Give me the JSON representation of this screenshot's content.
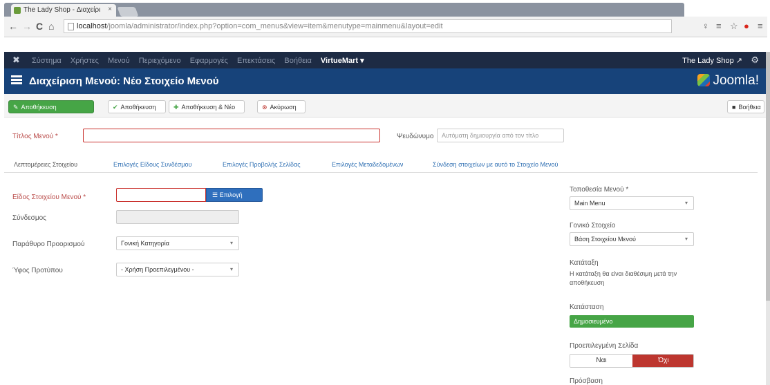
{
  "browser": {
    "tab_title": "The Lady Shop - Διαχείρι",
    "tab_close": "×",
    "url_host": "localhost",
    "url_rest": "/joomla/administrator/index.php?option=com_menus&view=item&menutype=mainmenu&layout=edit",
    "back": "←",
    "forward": "→",
    "reload": "C",
    "home": "⌂",
    "ext_icons": [
      "♀",
      "≡",
      "☆",
      "●",
      "≡"
    ]
  },
  "adminbar": {
    "logo": "✖",
    "menu": [
      "Σύστημα",
      "Χρήστες",
      "Μενού",
      "Περιεχόμενο",
      "Εφαρμογές",
      "Επεκτάσεις",
      "Βοήθεια"
    ],
    "virtuemart": "VirtueMart ▾",
    "site": "The Lady Shop ↗",
    "gear": "⚙"
  },
  "titlebar": {
    "title": "Διαχείριση Μενού: Νέο Στοιχείο Μενού",
    "brand": "Joomla!"
  },
  "toolbar": {
    "save": "Αποθήκευση",
    "save_close": "Αποθήκευση",
    "save_new": "Αποθήκευση & Νέο",
    "cancel": "Ακύρωση",
    "help": "Βοήθεια"
  },
  "form": {
    "title_label": "Τίτλος Μενού *",
    "alias_label": "Ψευδώνυμο",
    "alias_placeholder": "Αυτόματη δημιουργία από τον τίτλο",
    "tabs": [
      "Λεπτομέρειες Στοιχείου",
      "Επιλογές Είδους Συνδέσμου",
      "Επιλογές Προβολής Σελίδας",
      "Επιλογές Μεταδεδομένων",
      "Σύνδεση στοιχείων με αυτό το Στοιχείο Μενού"
    ],
    "type_label": "Είδος Στοιχείου Μενού *",
    "select_button": "Επιλογή",
    "link_label": "Σύνδεσμος",
    "target_label": "Παράθυρο Προορισμού",
    "target_value": "Γονική Κατηγορία",
    "style_label": "Ύφος Προτύπου",
    "style_value": "- Χρήση Προεπιλεγμένου -"
  },
  "side": {
    "menu_label": "Τοποθεσία Μενού *",
    "menu_value": "Main Menu",
    "parent_label": "Γονικό Στοιχείο",
    "parent_value": "Βάση Στοιχείου Μενού",
    "order_label": "Κατάταξη",
    "order_note": "Η κατάταξη θα είναι διαθέσιμη μετά την αποθήκευση",
    "status_label": "Κατάσταση",
    "status_value": "Δημοσιευμένο",
    "default_label": "Προεπιλεγμένη Σελίδα",
    "default_no": "Ναι",
    "default_yes": "Όχι",
    "access_label": "Πρόσβαση"
  }
}
